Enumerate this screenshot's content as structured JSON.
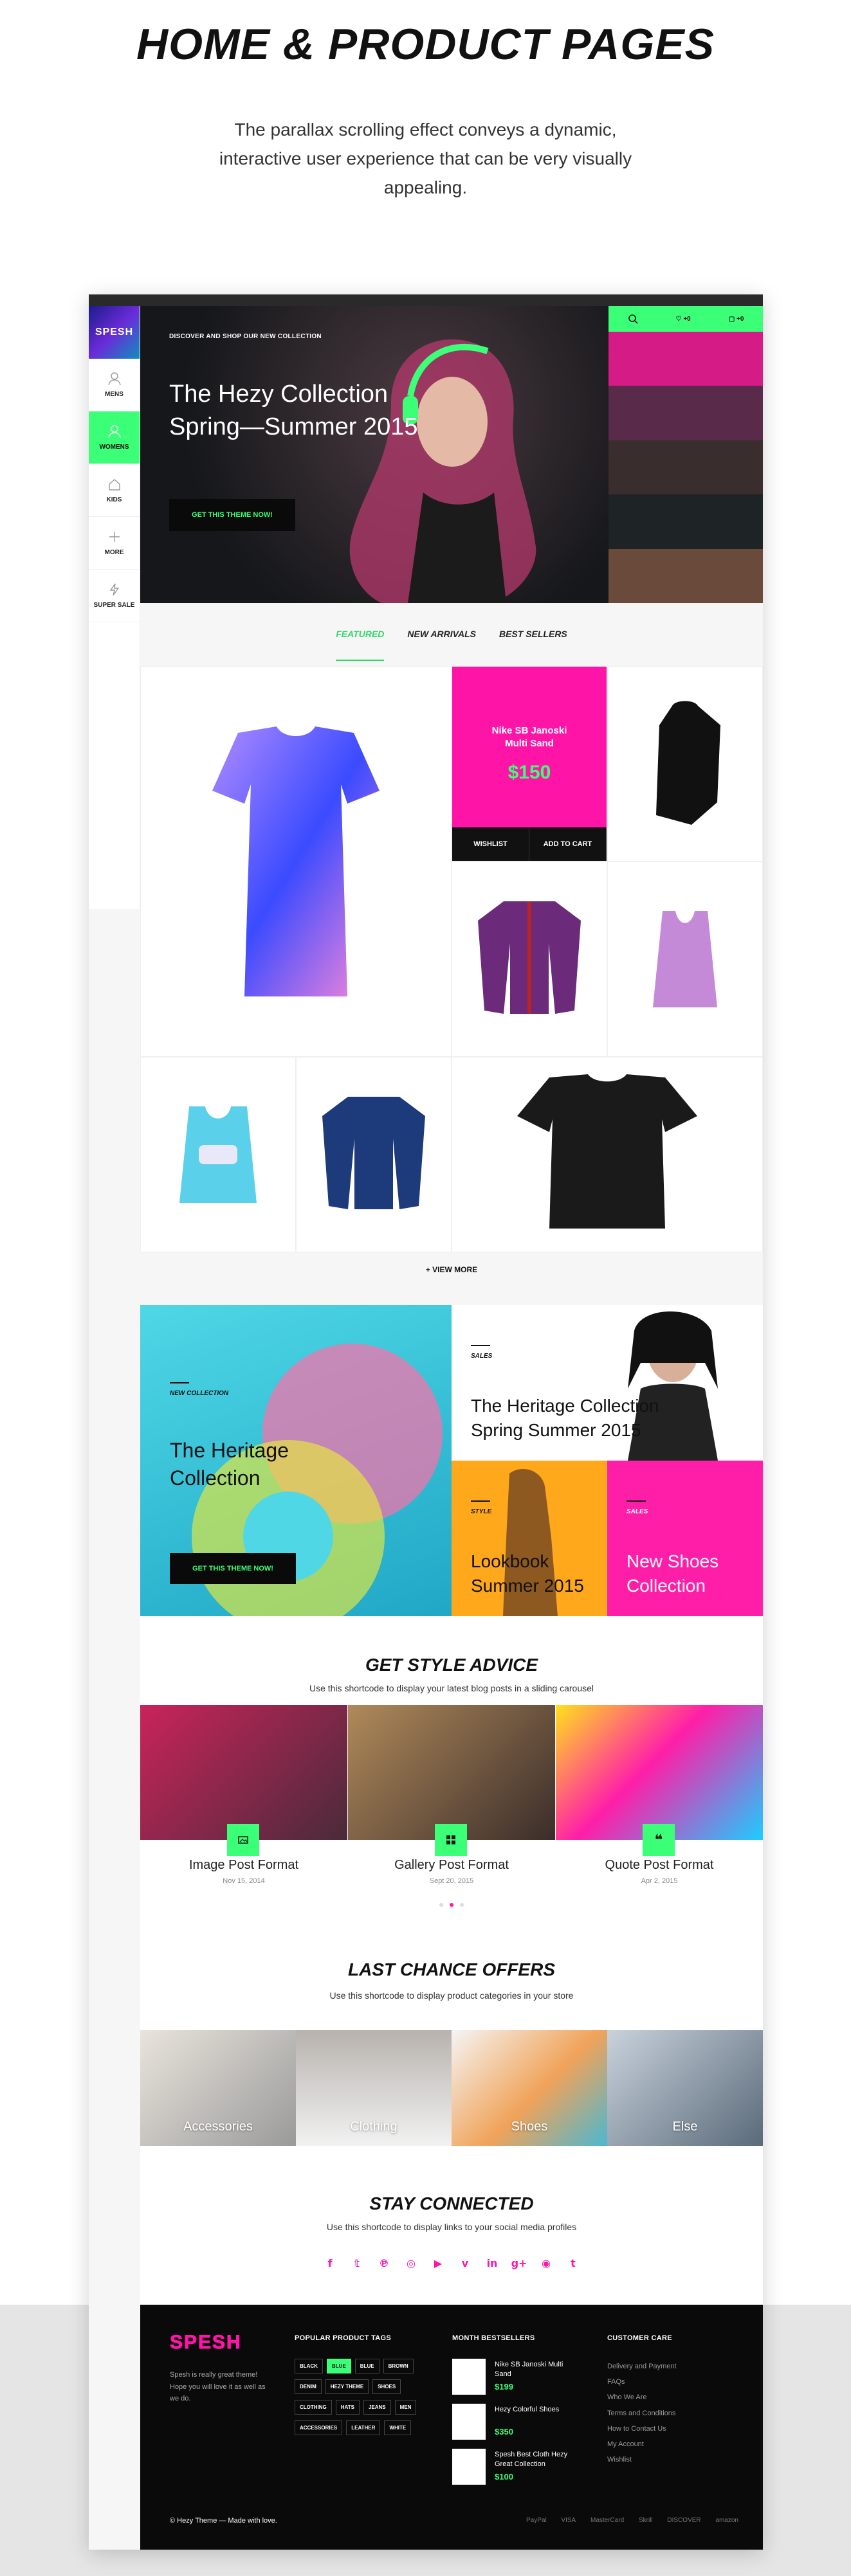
{
  "header": {
    "title": "HOME & PRODUCT PAGES",
    "intro": "The parallax scrolling effect conveys a dynamic, interactive user experience that can be very visually appealing."
  },
  "sidebar": {
    "logo": "SPESH",
    "items": [
      {
        "label": "MENS",
        "icon": "person-icon"
      },
      {
        "label": "WOMENS",
        "icon": "person-icon",
        "active": true
      },
      {
        "label": "KIDS",
        "icon": "house-icon"
      },
      {
        "label": "MORE",
        "icon": "plus-icon"
      },
      {
        "label": "SUPER SALE",
        "icon": "bolt-icon"
      }
    ]
  },
  "hero": {
    "eyebrow": "DISCOVER AND SHOP OUR NEW COLLECTION",
    "title_line1": "The Hezy Collection",
    "title_line2": "Spring—Summer 2015",
    "cta": "GET THIS THEME NOW!"
  },
  "util": {
    "wishlist_count": "+0",
    "cart_count": "+0"
  },
  "tabs": [
    "FEATURED",
    "NEW ARRIVALS",
    "BEST SELLERS"
  ],
  "featured_product": {
    "name_line1": "Nike SB Janoski",
    "name_line2": "Multi Sand",
    "price": "$150",
    "wishlist": "WISHLIST",
    "add_to_cart": "ADD TO CART"
  },
  "view_more": "+ VIEW MORE",
  "promos": {
    "heritage_tag": "NEW COLLECTION",
    "heritage_l1": "The Heritage",
    "heritage_l2": "Collection",
    "heritage_cta": "GET THIS THEME NOW!",
    "sales_tag": "SALES",
    "sales_l1": "The Heritage Collection",
    "sales_l2": "Spring Summer 2015",
    "style_tag": "STYLE",
    "style_l1": "Lookbook",
    "style_l2": "Summer 2015",
    "shoes_tag": "SALES",
    "shoes_l1": "New Shoes",
    "shoes_l2": "Collection"
  },
  "style_advice": {
    "title": "GET STYLE ADVICE",
    "subtitle": "Use this shortcode to display your latest blog posts in a sliding carousel",
    "posts": [
      {
        "title": "Image Post Format",
        "date": "Nov 15, 2014"
      },
      {
        "title": "Gallery Post Format",
        "date": "Sept 20, 2015"
      },
      {
        "title": "Quote Post Format",
        "date": "Apr 2, 2015"
      }
    ]
  },
  "last_chance": {
    "title": "LAST CHANCE OFFERS",
    "subtitle": "Use this shortcode to display product categories in your store",
    "categories": [
      "Accessories",
      "Clothing",
      "Shoes",
      "Else"
    ]
  },
  "stay_connected": {
    "title": "STAY CONNECTED",
    "subtitle": "Use this shortcode to display links to your social media profiles"
  },
  "footer": {
    "logo": "SPESH",
    "desc": "Spesh is really great theme! Hope you will love it as well as we do.",
    "tags_heading": "POPULAR PRODUCT TAGS",
    "tags": [
      "BLACK",
      "BLUE",
      "BLUE",
      "BROWN",
      "DENIM",
      "HEZY THEME",
      "SHOES",
      "CLOTHING",
      "HATS",
      "JEANS",
      "MEN",
      "ACCESSORIES",
      "LEATHER",
      "WHITE"
    ],
    "bestsellers_heading": "MONTH BESTSELLERS",
    "bestsellers": [
      {
        "name": "Nike SB Janoski Multi Sand",
        "price": "$199"
      },
      {
        "name": "Hezy Colorful Shoes",
        "price": "$350"
      },
      {
        "name": "Spesh Best Cloth Hezy Great Collection",
        "price": "$100"
      }
    ],
    "care_heading": "CUSTOMER CARE",
    "care_links": [
      "Delivery and Payment",
      "FAQs",
      "Who We Are",
      "Terms and Conditions",
      "How to Contact Us",
      "My Account",
      "Wishlist"
    ],
    "copyright": "© Hezy Theme — Made with love.",
    "payments": [
      "PayPal",
      "VISA",
      "MasterCard",
      "Skrill",
      "DISCOVER",
      "amazon"
    ]
  }
}
